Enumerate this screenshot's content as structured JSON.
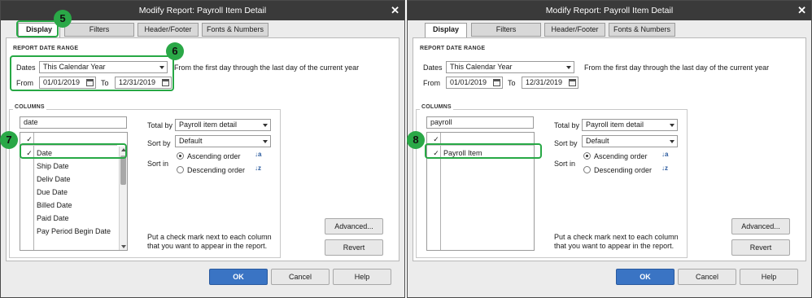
{
  "dialogs": [
    {
      "title": "Modify Report: Payroll Item Detail",
      "tabs": [
        "Display",
        "Filters",
        "Header/Footer",
        "Fonts & Numbers"
      ],
      "report_date_range_label": "REPORT DATE RANGE",
      "dates_label": "Dates",
      "dates_value": "This Calendar Year",
      "dates_description": "From the first day through the last day of the current year",
      "from_label": "From",
      "from_value": "01/01/2019",
      "to_label": "To",
      "to_value": "12/31/2019",
      "columns_label": "COLUMNS",
      "search_value": "date",
      "columns_list": [
        {
          "check": "✓",
          "label": ""
        },
        {
          "check": "✓",
          "label": "Date"
        },
        {
          "check": "",
          "label": "Ship Date"
        },
        {
          "check": "",
          "label": "Deliv Date"
        },
        {
          "check": "",
          "label": "Due Date"
        },
        {
          "check": "",
          "label": "Billed Date"
        },
        {
          "check": "",
          "label": "Paid Date"
        },
        {
          "check": "",
          "label": "Pay Period Begin Date"
        }
      ],
      "total_by_label": "Total by",
      "total_by_value": "Payroll item detail",
      "sort_by_label": "Sort by",
      "sort_by_value": "Default",
      "sort_in_label": "Sort in",
      "ascending_label": "Ascending order",
      "descending_label": "Descending order",
      "instruction": "Put a check mark next to each column that you want to appear in the report.",
      "advanced_label": "Advanced...",
      "revert_label": "Revert",
      "ok_label": "OK",
      "cancel_label": "Cancel",
      "help_label": "Help",
      "badges": [
        "5",
        "6",
        "7"
      ]
    },
    {
      "title": "Modify Report: Payroll Item Detail",
      "tabs": [
        "Display",
        "Filters",
        "Header/Footer",
        "Fonts & Numbers"
      ],
      "report_date_range_label": "REPORT DATE RANGE",
      "dates_label": "Dates",
      "dates_value": "This Calendar Year",
      "dates_description": "From the first day through the last day of the current year",
      "from_label": "From",
      "from_value": "01/01/2019",
      "to_label": "To",
      "to_value": "12/31/2019",
      "columns_label": "COLUMNS",
      "search_value": "payroll",
      "columns_list": [
        {
          "check": "✓",
          "label": ""
        },
        {
          "check": "✓",
          "label": "Payroll Item"
        }
      ],
      "total_by_label": "Total by",
      "total_by_value": "Payroll item detail",
      "sort_by_label": "Sort by",
      "sort_by_value": "Default",
      "sort_in_label": "Sort in",
      "ascending_label": "Ascending order",
      "descending_label": "Descending order",
      "instruction": "Put a check mark next to each column that you want to appear in the report.",
      "advanced_label": "Advanced...",
      "revert_label": "Revert",
      "ok_label": "OK",
      "cancel_label": "Cancel",
      "help_label": "Help",
      "badges": [
        "8"
      ]
    }
  ],
  "colors": {
    "accent": "#3a74c4",
    "highlight": "#27a845",
    "titlebar": "#3a3a3a"
  }
}
